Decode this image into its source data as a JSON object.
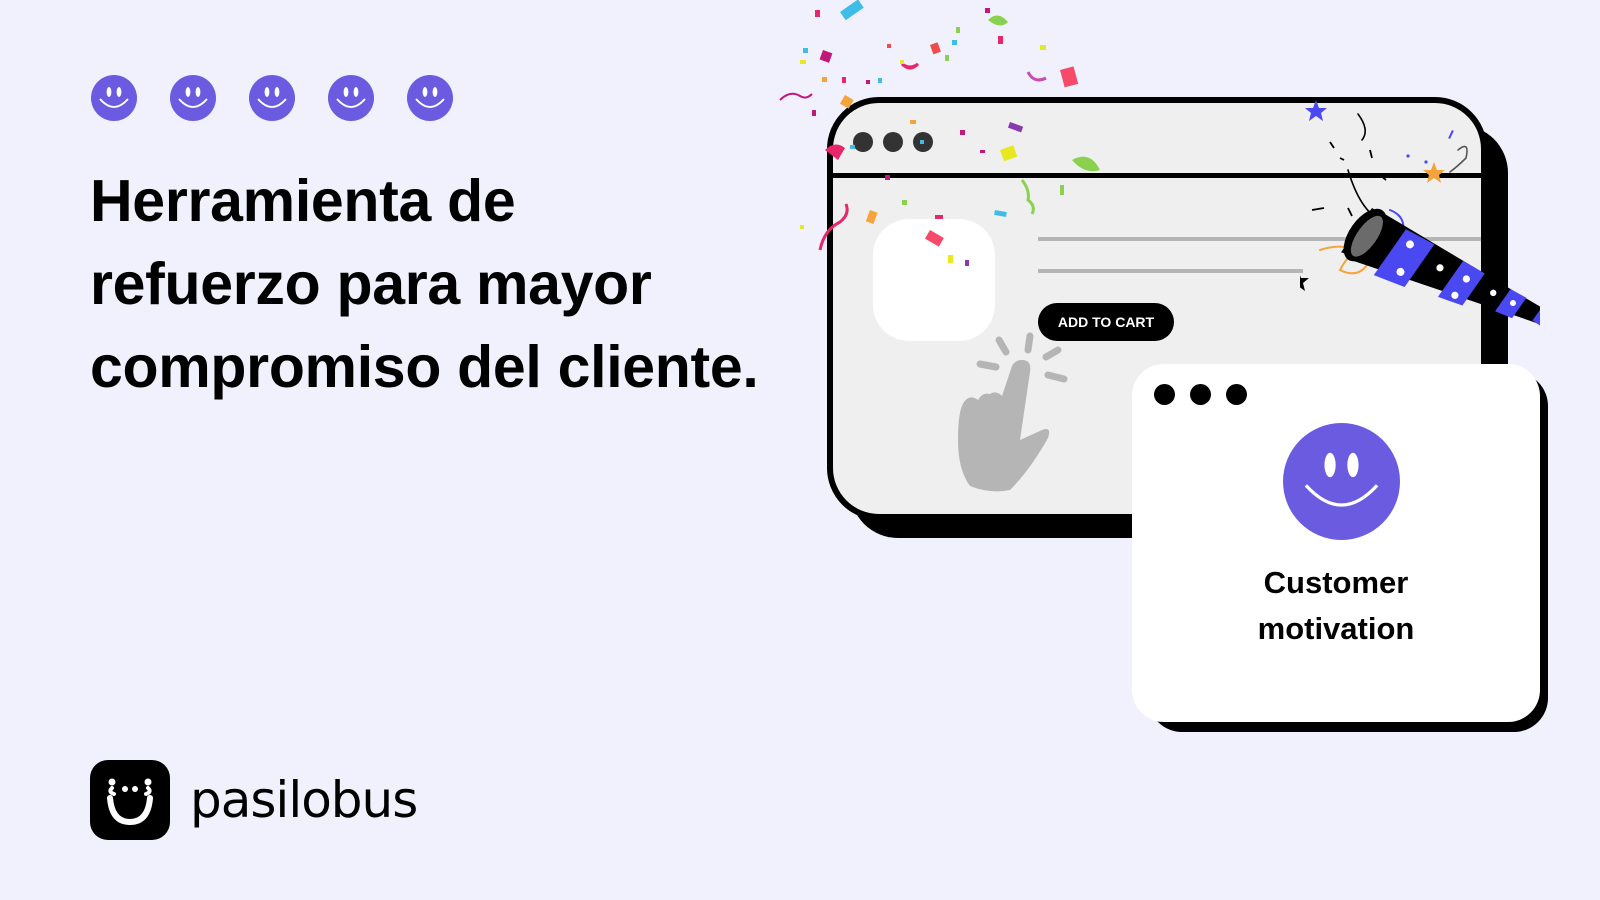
{
  "rating": {
    "count": 5,
    "icon": "smiley-face-icon",
    "color": "#6b5be0"
  },
  "headline": {
    "lines": [
      "Herramienta de",
      "refuerzo para mayor",
      "compromiso del cliente."
    ]
  },
  "brand": {
    "name": "pasilobus",
    "logo_icon": "pasilobus-logo-icon"
  },
  "illustration": {
    "product_window": {
      "button_label": "ADD TO CART",
      "cursor_icon": "pointing-hand-icon",
      "decoration_icons": [
        "confetti-icon",
        "party-popper-icon"
      ]
    },
    "motivation_card": {
      "title_lines": [
        "Customer",
        "motivation"
      ],
      "icon": "smiley-face-icon"
    }
  },
  "colors": {
    "background": "#f1f1fd",
    "accent": "#6b5be0",
    "popper_blue": "#4a48f0",
    "text": "#000000"
  }
}
